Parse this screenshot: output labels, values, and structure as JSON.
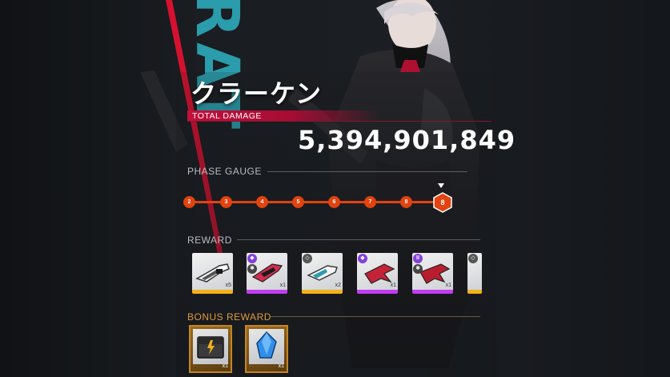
{
  "boss": {
    "name": "クラーケン",
    "watermark": "RAT"
  },
  "total_damage": {
    "label": "TOTAL DAMAGE",
    "value": "5,394,901,849"
  },
  "phase_gauge": {
    "label": "PHASE GAUGE",
    "phases": [
      "2",
      "3",
      "4",
      "5",
      "6",
      "7",
      "8"
    ],
    "current": "8"
  },
  "reward": {
    "label": "REWARD",
    "items": [
      {
        "name": "white-rifle",
        "rarity": "yellow",
        "badge": "",
        "qty": "x5"
      },
      {
        "name": "red-gun-purple",
        "rarity": "purple",
        "badge": "◆",
        "qty": "x1"
      },
      {
        "name": "white-gun",
        "rarity": "yellow",
        "badge": "◇",
        "qty": "x2"
      },
      {
        "name": "red-claw",
        "rarity": "purple",
        "badge": "◆",
        "qty": "x1"
      },
      {
        "name": "red-claw-2",
        "rarity": "purple",
        "badge": "II",
        "qty": "x1"
      },
      {
        "name": "cut-item",
        "rarity": "yellow",
        "badge": "◇",
        "qty": ""
      }
    ]
  },
  "bonus_reward": {
    "label": "BONUS REWARD",
    "items": [
      {
        "name": "chest",
        "qty": "x1"
      },
      {
        "name": "blue-crystal",
        "qty": "x1"
      }
    ]
  },
  "colors": {
    "accent": "#e2430f",
    "total_bar": "#c40f3c",
    "bonus_label": "#e09a3a"
  }
}
